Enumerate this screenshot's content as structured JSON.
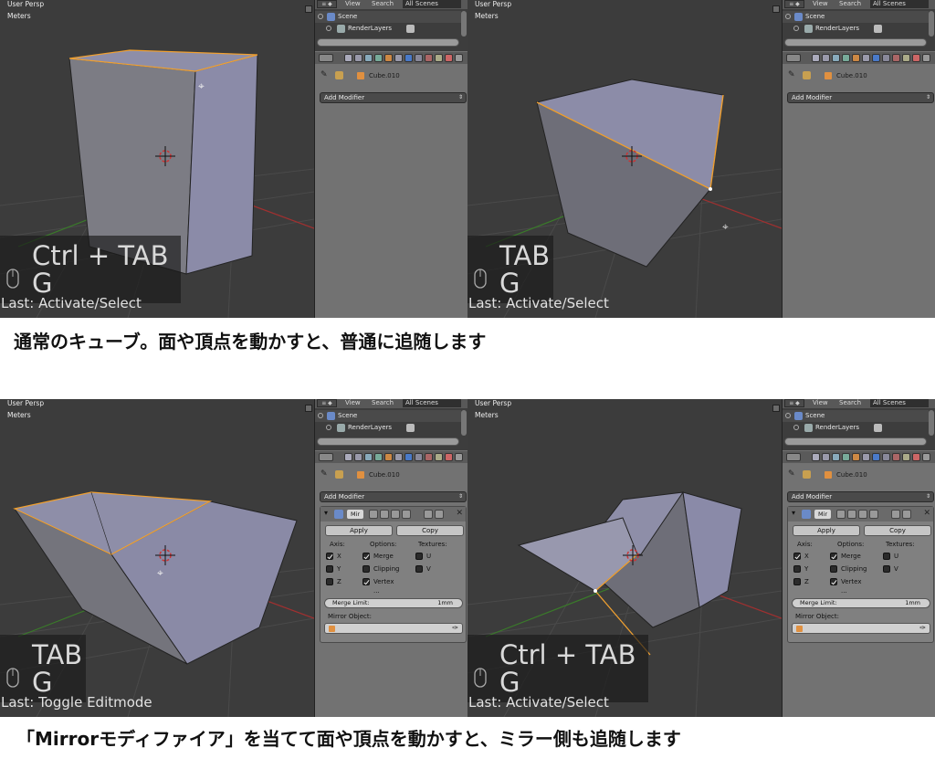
{
  "panels": [
    {
      "viewport": {
        "persp_label": "User Persp",
        "units_label": "Meters"
      },
      "outliner": {
        "editor_label": "≡ ◆",
        "header_view": "View",
        "header_search": "Search",
        "header_scenes": "All Scenes",
        "scene_label": "Scene",
        "renderlayers_label": "RenderLayers"
      },
      "object_name": "Cube.010",
      "add_modifier_label": "Add Modifier",
      "key_line1": "Ctrl + TAB",
      "key_line2": "G",
      "last_operator": "Last: Activate/Select"
    },
    {
      "viewport": {
        "persp_label": "User Persp",
        "units_label": "Meters"
      },
      "outliner": {
        "editor_label": "≡ ◆",
        "header_view": "View",
        "header_search": "Search",
        "header_scenes": "All Scenes",
        "scene_label": "Scene",
        "renderlayers_label": "RenderLayers"
      },
      "object_name": "Cube.010",
      "add_modifier_label": "Add Modifier",
      "key_line1": "TAB",
      "key_line2": "G",
      "last_operator": "Last: Activate/Select"
    },
    {
      "viewport": {
        "persp_label": "User Persp",
        "units_label": "Meters"
      },
      "outliner": {
        "editor_label": "≡ ◆",
        "header_view": "View",
        "header_search": "Search",
        "header_scenes": "All Scenes",
        "scene_label": "Scene",
        "renderlayers_label": "RenderLayers"
      },
      "object_name": "Cube.010",
      "add_modifier_label": "Add Modifier",
      "modifier": {
        "name": "Mir",
        "apply_label": "Apply",
        "copy_label": "Copy",
        "axis_label": "Axis:",
        "options_label": "Options:",
        "textures_label": "Textures:",
        "x_label": "X",
        "y_label": "Y",
        "z_label": "Z",
        "merge_label": "Merge",
        "clipping_label": "Clipping",
        "vertex_label": "Vertex ...",
        "u_label": "U",
        "v_label": "V",
        "merge_limit_label": "Merge Limit:",
        "merge_limit_value": "1mm",
        "mirror_object_label": "Mirror Object:"
      },
      "key_line1": "TAB",
      "key_line2": "G",
      "last_operator": "Last: Toggle Editmode"
    },
    {
      "viewport": {
        "persp_label": "User Persp",
        "units_label": "Meters"
      },
      "outliner": {
        "editor_label": "≡ ◆",
        "header_view": "View",
        "header_search": "Search",
        "header_scenes": "All Scenes",
        "scene_label": "Scene",
        "renderlayers_label": "RenderLayers"
      },
      "object_name": "Cube.010",
      "add_modifier_label": "Add Modifier",
      "modifier": {
        "name": "Mir",
        "apply_label": "Apply",
        "copy_label": "Copy",
        "axis_label": "Axis:",
        "options_label": "Options:",
        "textures_label": "Textures:",
        "x_label": "X",
        "y_label": "Y",
        "z_label": "Z",
        "merge_label": "Merge",
        "clipping_label": "Clipping",
        "vertex_label": "Vertex ...",
        "u_label": "U",
        "v_label": "V",
        "merge_limit_label": "Merge Limit:",
        "merge_limit_value": "1mm",
        "mirror_object_label": "Mirror Object:"
      },
      "key_line1": "Ctrl + TAB",
      "key_line2": "G",
      "last_operator": "Last: Activate/Select"
    }
  ],
  "captions": {
    "top": "通常のキューブ。面や頂点を動かすと、普通に追随します",
    "bottom": "「Mirrorモディファイア」を当てて面や頂点を動かすと、ミラー側も追随します"
  },
  "colors": {
    "viewport_bg": "#3c3c3c",
    "face_light": "#8c8ca8",
    "face_dark": "#6e6e78",
    "selected_edge": "#f0a030",
    "panel_bg": "#727272",
    "x_axis": "#a03030",
    "y_axis": "#3a7a2a"
  },
  "icons": [
    "mouse-icon",
    "cursor-3d-icon",
    "wrench-icon",
    "mirror-modifier-icon",
    "object-icon",
    "close-icon",
    "eyedropper-icon"
  ]
}
